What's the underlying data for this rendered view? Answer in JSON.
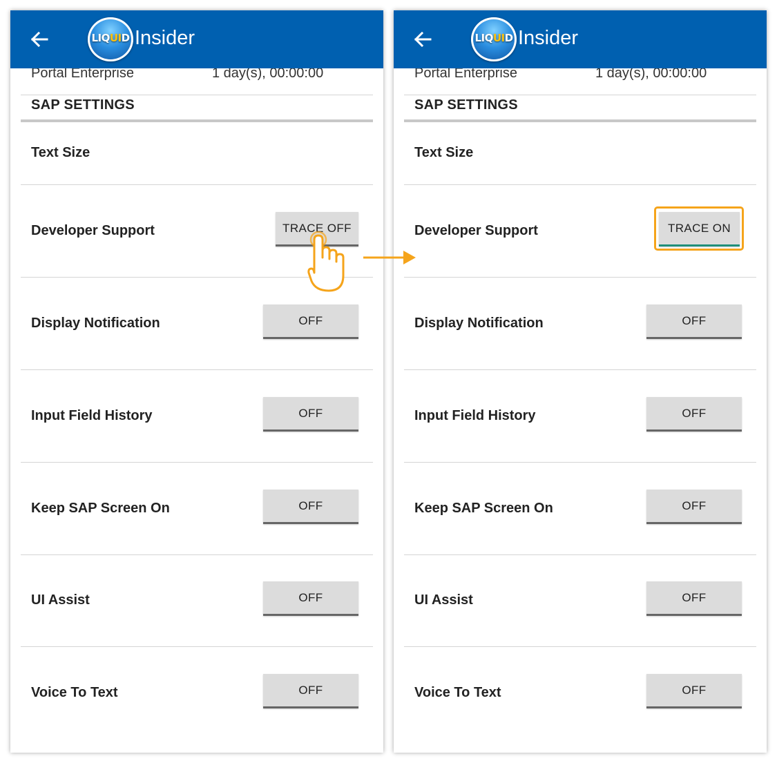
{
  "app": {
    "name": "Insider",
    "logo": {
      "main": "LIQ",
      "highlight": "UI",
      "end": "D"
    },
    "back_icon": "arrow-left-icon",
    "brand_color": "#0060b0"
  },
  "scrolled_row": {
    "left_text": "Portal Enterprise",
    "right_text": "1 day(s), 00:00:00"
  },
  "section_title": "SAP SETTINGS",
  "left_panel": {
    "rows": [
      {
        "label": "Text Size"
      },
      {
        "label": "Developer Support",
        "button": "TRACE OFF"
      },
      {
        "label": "Display Notification",
        "button": "OFF"
      },
      {
        "label": "Input Field History",
        "button": "OFF"
      },
      {
        "label": "Keep SAP Screen On",
        "button": "OFF"
      },
      {
        "label": "UI Assist",
        "button": "OFF"
      },
      {
        "label": "Voice To Text",
        "button": "OFF"
      }
    ]
  },
  "right_panel": {
    "rows": [
      {
        "label": "Text Size"
      },
      {
        "label": "Developer Support",
        "button": "TRACE ON"
      },
      {
        "label": "Display Notification",
        "button": "OFF"
      },
      {
        "label": "Input Field History",
        "button": "OFF"
      },
      {
        "label": "Keep SAP Screen On",
        "button": "OFF"
      },
      {
        "label": "UI Assist",
        "button": "OFF"
      },
      {
        "label": "Voice To Text",
        "button": "OFF"
      }
    ]
  },
  "annotations": {
    "tap_icon": "hand-pointer-icon",
    "arrow_icon": "arrow-right-icon",
    "highlight_color": "#f5a41b",
    "active_underline_color": "#1f8f7a"
  }
}
